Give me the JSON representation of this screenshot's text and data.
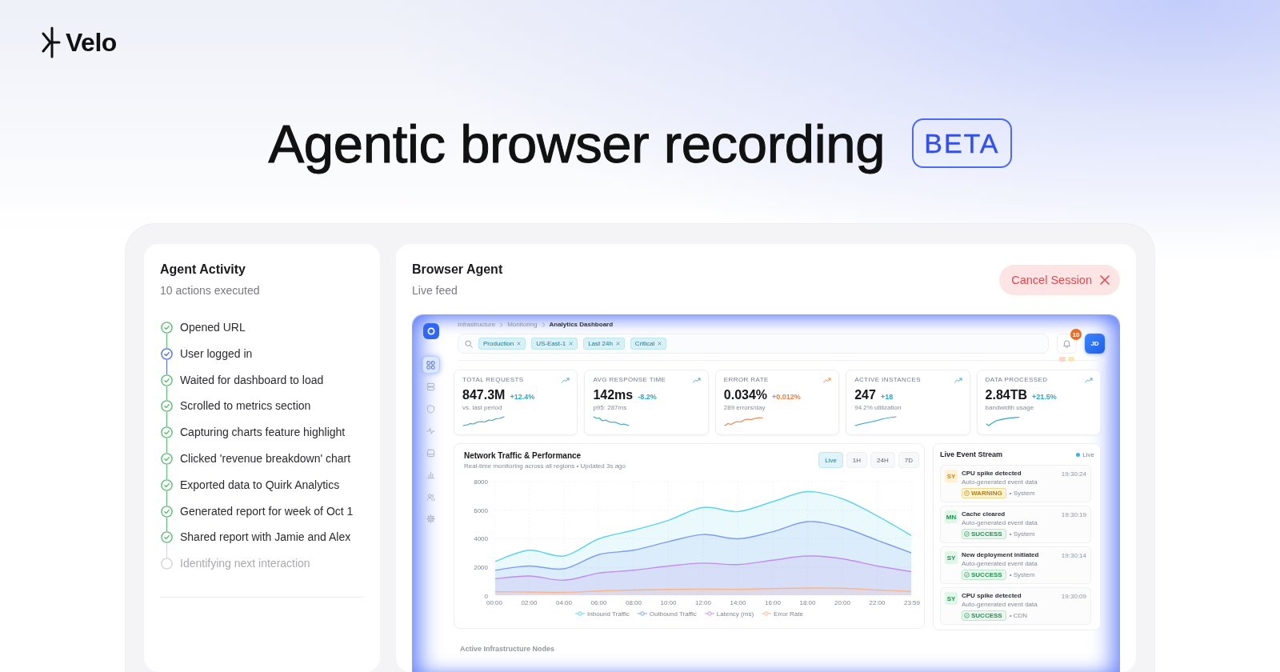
{
  "brand": {
    "name": "Velo"
  },
  "hero": {
    "title": "Agentic browser recording",
    "badge": "BETA"
  },
  "activity_panel": {
    "title": "Agent Activity",
    "subtitle": "10 actions executed",
    "steps": [
      {
        "label": "Opened URL",
        "done": true,
        "active": false
      },
      {
        "label": "User logged in",
        "done": true,
        "active": true
      },
      {
        "label": "Waited for dashboard to load",
        "done": true,
        "active": false
      },
      {
        "label": "Scrolled to metrics section",
        "done": true,
        "active": false
      },
      {
        "label": "Capturing charts feature highlight",
        "done": true,
        "active": false
      },
      {
        "label": "Clicked 'revenue breakdown' chart",
        "done": true,
        "active": false
      },
      {
        "label": "Exported data to Quirk Analytics",
        "done": true,
        "active": false
      },
      {
        "label": "Generated report for week of Oct 1",
        "done": true,
        "active": false
      },
      {
        "label": "Shared report with Jamie and Alex",
        "done": true,
        "active": false
      },
      {
        "label": "Identifying next interaction",
        "done": false,
        "active": false
      }
    ]
  },
  "agent_panel": {
    "title": "Browser Agent",
    "subtitle": "Live feed",
    "cancel_button": "Cancel Session",
    "dashboard": {
      "nav": [
        {
          "kind": "grid",
          "selected": true
        },
        {
          "kind": "server",
          "selected": false
        },
        {
          "kind": "shield",
          "selected": false
        },
        {
          "kind": "activity",
          "selected": false
        },
        {
          "kind": "drive",
          "selected": false
        },
        {
          "kind": "chart",
          "selected": false
        },
        {
          "kind": "users",
          "selected": false
        },
        {
          "kind": "settings",
          "selected": false
        }
      ],
      "breadcrumb": [
        "Infrastructure",
        "Monitoring",
        "Analytics Dashboard"
      ],
      "filters": [
        "Production",
        "US-East-1",
        "Last 24h",
        "Critical"
      ],
      "notification_count": "10",
      "user_initials": "JD",
      "metrics": [
        {
          "label": "TOTAL REQUESTS",
          "value": "847.3M",
          "change": "+12.4%",
          "note": "vs. last period",
          "color": "#2aa8c4"
        },
        {
          "label": "AVG RESPONSE TIME",
          "value": "142ms",
          "change": "-8.2%",
          "note": "p95: 287ms",
          "color": "#2aa8c4"
        },
        {
          "label": "ERROR RATE",
          "value": "0.034%",
          "change": "+0.012%",
          "note": "289 errors/day",
          "color": "#f47c3c"
        },
        {
          "label": "ACTIVE INSTANCES",
          "value": "247",
          "change": "+18",
          "note": "94.2% utilization",
          "color": "#2aa8c4"
        },
        {
          "label": "DATA PROCESSED",
          "value": "2.84TB",
          "change": "+21.5%",
          "note": "bandwidth usage",
          "color": "#2aa8c4"
        }
      ],
      "traffic_card": {
        "subtitle": "Real-time monitoring across all regions • Updated 3s ago",
        "ranges": [
          {
            "label": "Live",
            "selected": true
          },
          {
            "label": "1H",
            "selected": false
          },
          {
            "label": "24H",
            "selected": false
          },
          {
            "label": "7D",
            "selected": false
          }
        ],
        "chart_data": {
          "type": "area",
          "title": "Network Traffic & Performance",
          "categories": [
            "00:00",
            "02:00",
            "04:00",
            "06:00",
            "08:00",
            "10:00",
            "12:00",
            "14:00",
            "16:00",
            "18:00",
            "20:00",
            "22:00",
            "23:59"
          ],
          "series": [
            {
              "name": "Inbound Traffic",
              "color": "#5fd3ea",
              "values": [
                2400,
                3200,
                2800,
                4000,
                4600,
                5300,
                6200,
                5900,
                6600,
                7300,
                6800,
                5600,
                4200
              ]
            },
            {
              "name": "Outbound Traffic",
              "color": "#7f9df0",
              "values": [
                1800,
                2100,
                1900,
                2900,
                3200,
                3800,
                4300,
                4000,
                4500,
                5200,
                4800,
                3900,
                3000
              ]
            },
            {
              "name": "Latency (ms)",
              "color": "#c38df0",
              "values": [
                1200,
                1400,
                1100,
                1600,
                1800,
                2100,
                2300,
                2200,
                2500,
                2800,
                2600,
                2100,
                1700
              ]
            },
            {
              "name": "Error Rate",
              "color": "#fbb48a",
              "values": [
                300,
                280,
                250,
                350,
                420,
                460,
                480,
                470,
                520,
                560,
                540,
                420,
                320
              ]
            }
          ],
          "ylim": [
            0,
            8000
          ],
          "yticks": [
            0,
            2000,
            4000,
            6000,
            8000
          ],
          "grid": true
        }
      },
      "event_stream": {
        "title": "Live Event Stream",
        "status": "Live",
        "events": [
          {
            "initials": "SY",
            "title": "CPU spike detected",
            "time": "19:30:24",
            "description": "Auto-generated event data",
            "kind": "warning",
            "badge": "WARNING",
            "source": "• System"
          },
          {
            "initials": "MN",
            "title": "Cache cleared",
            "time": "19:30:19",
            "description": "Auto-generated event data",
            "kind": "success",
            "badge": "SUCCESS",
            "source": "• System"
          },
          {
            "initials": "SY",
            "title": "New deployment initiated",
            "time": "19:30:14",
            "description": "Auto-generated event data",
            "kind": "success",
            "badge": "SUCCESS",
            "source": "• System"
          },
          {
            "initials": "SY",
            "title": "CPU spike detected",
            "time": "19:30:09",
            "description": "Auto-generated event data",
            "kind": "success",
            "badge": "SUCCESS",
            "source": "• CDN"
          }
        ]
      },
      "next_section": "Active Infrastructure Nodes"
    }
  }
}
